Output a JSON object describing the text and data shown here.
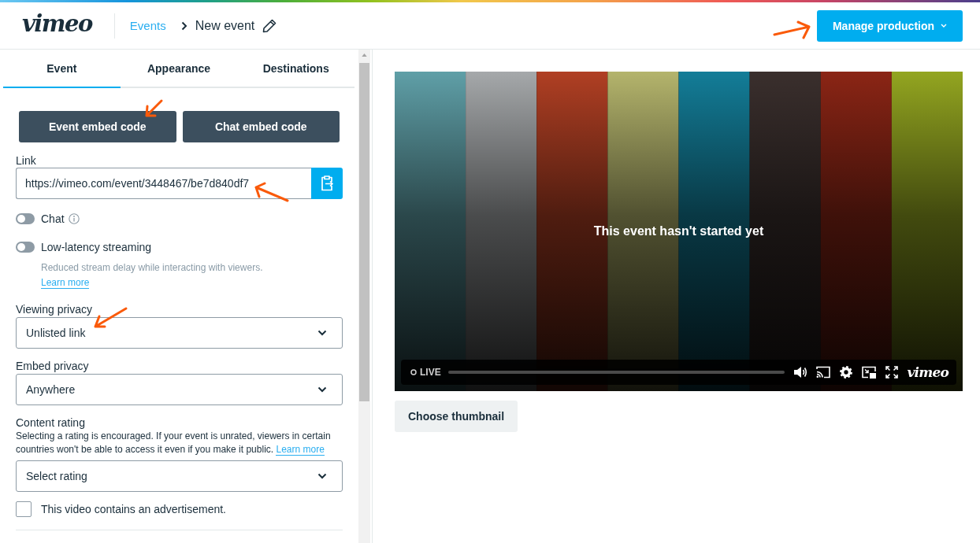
{
  "header": {
    "logo": "vimeo",
    "breadcrumb": [
      {
        "label": "Events",
        "kind": "link"
      },
      {
        "label": "New event",
        "kind": "current"
      }
    ],
    "action_button": "Manage production"
  },
  "tabs": [
    {
      "label": "Event",
      "selected": true
    },
    {
      "label": "Appearance",
      "selected": false
    },
    {
      "label": "Destinations",
      "selected": false
    }
  ],
  "embed_buttons": [
    "Event embed code",
    "Chat embed code"
  ],
  "link_field": {
    "label": "Link",
    "value": "https://vimeo.com/event/3448467/be7d840df7"
  },
  "toggles": [
    {
      "label": "Chat",
      "on": false,
      "info": true
    },
    {
      "label": "Low-latency streaming",
      "on": false,
      "description": "Reduced stream delay while interacting with viewers.",
      "link": "Learn more"
    }
  ],
  "selects": [
    {
      "label": "Viewing privacy",
      "value": "Unlisted link"
    },
    {
      "label": "Embed privacy",
      "value": "Anywhere"
    },
    {
      "label": "Content rating",
      "description": "Selecting a rating is encouraged. If your event is unrated, viewers in certain countries won't be able to access it even if you make it public.",
      "link": "Learn more",
      "value": "Select rating"
    }
  ],
  "checkbox": {
    "label": "This video contains an advertisement.",
    "checked": false
  },
  "player": {
    "message": "This event hasn't started yet",
    "live_label": "LIVE",
    "watermark": "vimeo"
  },
  "thumbnail_button": "Choose thumbnail"
}
